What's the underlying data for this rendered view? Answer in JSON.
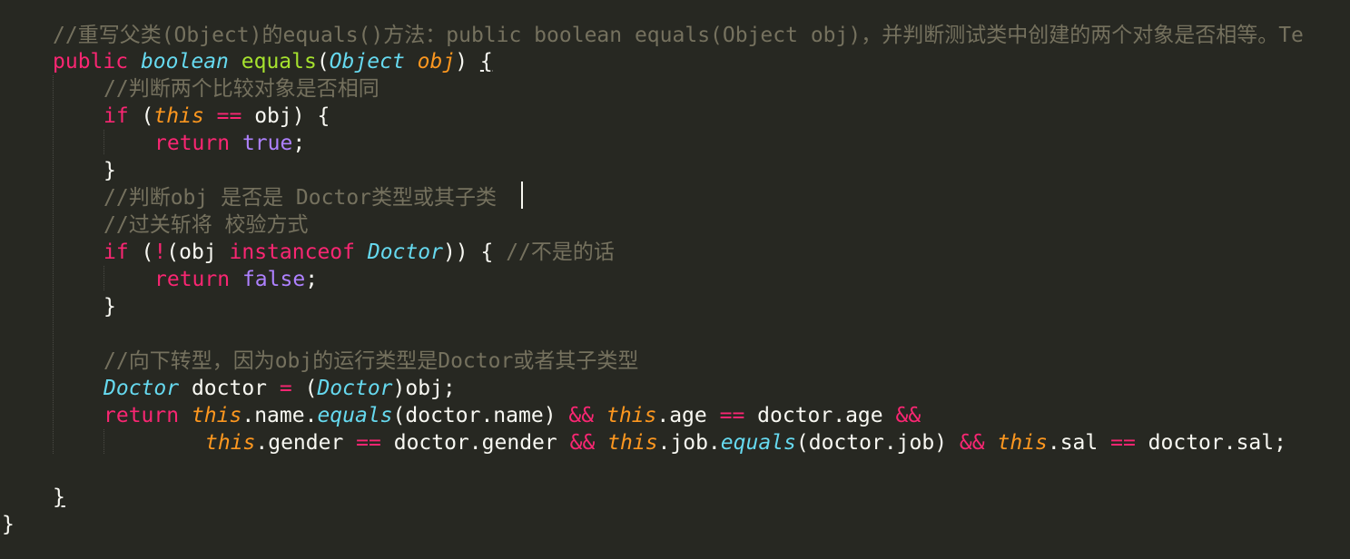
{
  "editor": {
    "theme": {
      "background": "#272822",
      "keyword": "#f92672",
      "type": "#66d9ef",
      "this": "#fd971f",
      "function": "#a6e22e",
      "comment": "#75715e",
      "plain": "#f8f8f2",
      "boolean": "#ae81ff"
    },
    "lines": [
      {
        "indent": 1,
        "tokens": [
          {
            "c": "cm",
            "t": "//重写父类(Object)的equals()方法：public boolean equals(Object obj)，并判断测试类中创建的两个对象是否相等。Te"
          }
        ]
      },
      {
        "indent": 1,
        "tokens": [
          {
            "c": "kw",
            "t": "public"
          },
          {
            "c": "pl",
            "t": " "
          },
          {
            "c": "ty",
            "t": "boolean"
          },
          {
            "c": "pl",
            "t": " "
          },
          {
            "c": "fn",
            "t": "equals"
          },
          {
            "c": "pl",
            "t": "("
          },
          {
            "c": "ty",
            "t": "Object"
          },
          {
            "c": "pl",
            "t": " "
          },
          {
            "c": "th",
            "t": "obj"
          },
          {
            "c": "pl",
            "t": ") "
          },
          {
            "c": "pl ul",
            "t": "{"
          }
        ]
      },
      {
        "indent": 2,
        "tokens": [
          {
            "c": "cm",
            "t": "//判断两个比较对象是否相同"
          }
        ]
      },
      {
        "indent": 2,
        "tokens": [
          {
            "c": "kw",
            "t": "if"
          },
          {
            "c": "pl",
            "t": " ("
          },
          {
            "c": "th",
            "t": "this"
          },
          {
            "c": "pl",
            "t": " "
          },
          {
            "c": "kw",
            "t": "=="
          },
          {
            "c": "pl",
            "t": " obj) {"
          }
        ]
      },
      {
        "indent": 3,
        "tokens": [
          {
            "c": "kw",
            "t": "return"
          },
          {
            "c": "pl",
            "t": " "
          },
          {
            "c": "bl",
            "t": "true"
          },
          {
            "c": "pl",
            "t": ";"
          }
        ]
      },
      {
        "indent": 2,
        "tokens": [
          {
            "c": "pl",
            "t": "}"
          }
        ]
      },
      {
        "indent": 2,
        "tokens": [
          {
            "c": "cm",
            "t": "//判断obj 是否是 Doctor类型或其子类"
          }
        ]
      },
      {
        "indent": 2,
        "tokens": [
          {
            "c": "cm",
            "t": "//过关斩将 校验方式"
          }
        ]
      },
      {
        "indent": 2,
        "tokens": [
          {
            "c": "kw",
            "t": "if"
          },
          {
            "c": "pl",
            "t": " ("
          },
          {
            "c": "kw",
            "t": "!"
          },
          {
            "c": "pl",
            "t": "(obj "
          },
          {
            "c": "kw",
            "t": "instanceof"
          },
          {
            "c": "pl",
            "t": " "
          },
          {
            "c": "ty",
            "t": "Doctor"
          },
          {
            "c": "pl",
            "t": ")) { "
          },
          {
            "c": "cm",
            "t": "//不是的话"
          }
        ]
      },
      {
        "indent": 3,
        "tokens": [
          {
            "c": "kw",
            "t": "return"
          },
          {
            "c": "pl",
            "t": " "
          },
          {
            "c": "bl",
            "t": "false"
          },
          {
            "c": "pl",
            "t": ";"
          }
        ]
      },
      {
        "indent": 2,
        "tokens": [
          {
            "c": "pl",
            "t": "}"
          }
        ]
      },
      {
        "indent": 2,
        "tokens": []
      },
      {
        "indent": 2,
        "tokens": [
          {
            "c": "cm",
            "t": "//向下转型，因为obj的运行类型是Doctor或者其子类型"
          }
        ]
      },
      {
        "indent": 2,
        "tokens": [
          {
            "c": "ty",
            "t": "Doctor"
          },
          {
            "c": "pl",
            "t": " doctor "
          },
          {
            "c": "kw",
            "t": "="
          },
          {
            "c": "pl",
            "t": " ("
          },
          {
            "c": "ty",
            "t": "Doctor"
          },
          {
            "c": "pl",
            "t": ")obj;"
          }
        ]
      },
      {
        "indent": 2,
        "tokens": [
          {
            "c": "kw",
            "t": "return"
          },
          {
            "c": "pl",
            "t": " "
          },
          {
            "c": "th",
            "t": "this"
          },
          {
            "c": "pl",
            "t": ".name."
          },
          {
            "c": "ty",
            "t": "equals"
          },
          {
            "c": "pl",
            "t": "(doctor.name) "
          },
          {
            "c": "kw",
            "t": "&&"
          },
          {
            "c": "pl",
            "t": " "
          },
          {
            "c": "th",
            "t": "this"
          },
          {
            "c": "pl",
            "t": ".age "
          },
          {
            "c": "kw",
            "t": "=="
          },
          {
            "c": "pl",
            "t": " doctor.age "
          },
          {
            "c": "kw",
            "t": "&&"
          }
        ]
      },
      {
        "indent": 4,
        "tokens": [
          {
            "c": "th",
            "t": "this"
          },
          {
            "c": "pl",
            "t": ".gender "
          },
          {
            "c": "kw",
            "t": "=="
          },
          {
            "c": "pl",
            "t": " doctor.gender "
          },
          {
            "c": "kw",
            "t": "&&"
          },
          {
            "c": "pl",
            "t": " "
          },
          {
            "c": "th",
            "t": "this"
          },
          {
            "c": "pl",
            "t": ".job."
          },
          {
            "c": "ty",
            "t": "equals"
          },
          {
            "c": "pl",
            "t": "(doctor.job) "
          },
          {
            "c": "kw",
            "t": "&&"
          },
          {
            "c": "pl",
            "t": " "
          },
          {
            "c": "th",
            "t": "this"
          },
          {
            "c": "pl",
            "t": ".sal "
          },
          {
            "c": "kw",
            "t": "=="
          },
          {
            "c": "pl",
            "t": " doctor.sal;"
          }
        ]
      },
      {
        "indent": 1,
        "tokens": []
      },
      {
        "indent": 1,
        "tokens": [
          {
            "c": "pl ul",
            "t": "}"
          }
        ]
      },
      {
        "indent": 0,
        "tokens": [
          {
            "c": "pl",
            "t": "}"
          }
        ]
      }
    ]
  }
}
